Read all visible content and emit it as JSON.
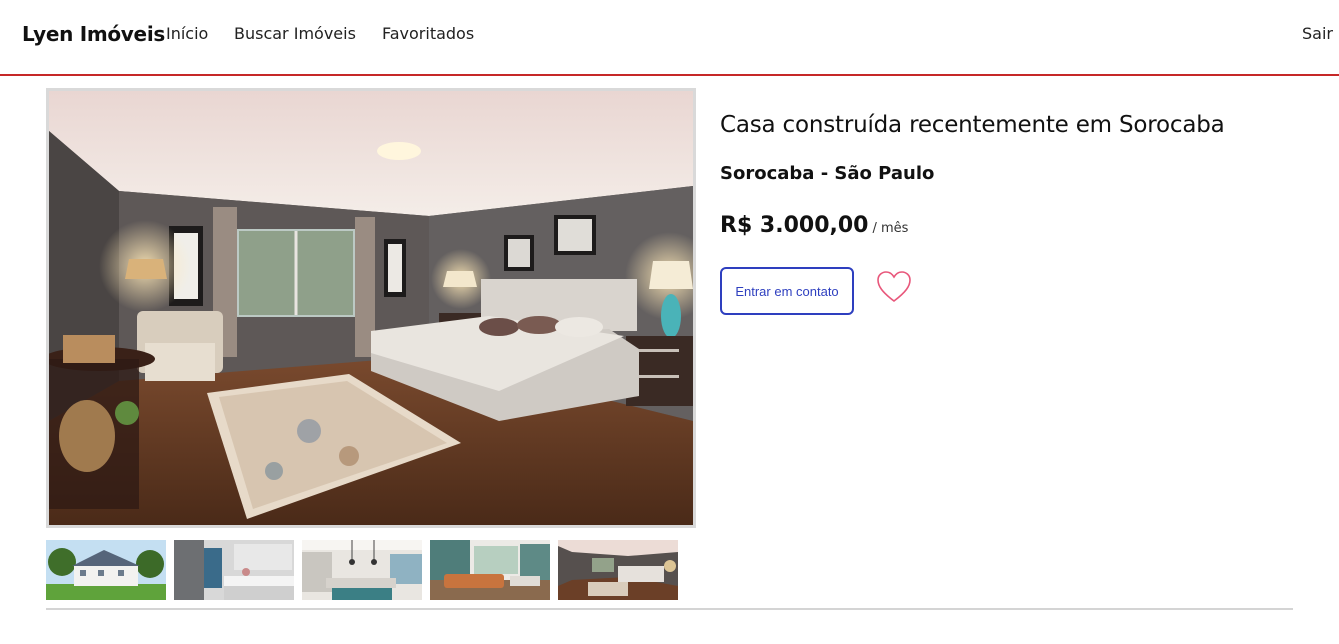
{
  "navbar": {
    "brand": "Lyen Imóveis",
    "links": [
      "Início",
      "Buscar Imóveis",
      "Favoritados"
    ],
    "logout": "Sair",
    "accent_color": "#c62828"
  },
  "gallery": {
    "main_image": "bedroom-photo",
    "thumbnails": [
      "house-exterior-photo",
      "bathroom-photo",
      "kitchen-photo",
      "living-room-photo",
      "bedroom-photo"
    ]
  },
  "listing": {
    "title": "Casa construída recentemente em Sorocaba",
    "location": "Sorocaba - São Paulo",
    "price": "R$ 3.000,00",
    "price_period": "/ mês",
    "contact_button": "Entrar em contato",
    "favorite_icon": "heart-icon",
    "button_color": "#2e3fbf",
    "heart_color": "#e8577b"
  }
}
